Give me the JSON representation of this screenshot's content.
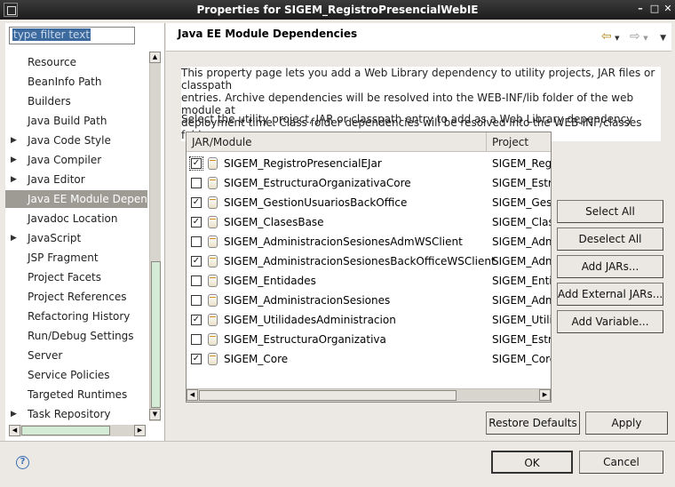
{
  "window": {
    "title": "Properties for SIGEM_RegistroPresencialWebIE",
    "minimize": "–",
    "maximize": "□",
    "close": "✕"
  },
  "filter": {
    "placeholder": "type filter text"
  },
  "tree": [
    {
      "label": "Resource",
      "expandable": false
    },
    {
      "label": "BeanInfo Path",
      "expandable": false
    },
    {
      "label": "Builders",
      "expandable": false
    },
    {
      "label": "Java Build Path",
      "expandable": false
    },
    {
      "label": "Java Code Style",
      "expandable": true
    },
    {
      "label": "Java Compiler",
      "expandable": true
    },
    {
      "label": "Java Editor",
      "expandable": true
    },
    {
      "label": "Java EE Module Depend",
      "expandable": false,
      "selected": true
    },
    {
      "label": "Javadoc Location",
      "expandable": false
    },
    {
      "label": "JavaScript",
      "expandable": true
    },
    {
      "label": "JSP Fragment",
      "expandable": false
    },
    {
      "label": "Project Facets",
      "expandable": false
    },
    {
      "label": "Project References",
      "expandable": false
    },
    {
      "label": "Refactoring History",
      "expandable": false
    },
    {
      "label": "Run/Debug Settings",
      "expandable": false
    },
    {
      "label": "Server",
      "expandable": false
    },
    {
      "label": "Service Policies",
      "expandable": false
    },
    {
      "label": "Targeted Runtimes",
      "expandable": false
    },
    {
      "label": "Task Repository",
      "expandable": true
    }
  ],
  "page": {
    "title": "Java EE Module Dependencies",
    "description_lines": [
      "This property page lets you add a Web Library dependency to utility projects, JAR files or classpath",
      "entries. Archive dependencies will be resolved into the WEB-INF/lib folder of the web module at",
      "deployment time. Class folder dependencies will be resolved into the WEB-INF/classes folder."
    ],
    "instruction": "Select the utility project, JAR or classpath entry to add as a Web Library dependency"
  },
  "table": {
    "columns": [
      "JAR/Module",
      "Project"
    ],
    "rows": [
      {
        "module": "SIGEM_RegistroPresencialEJar",
        "project": "SIGEM_Regi",
        "checked": true
      },
      {
        "module": "SIGEM_EstructuraOrganizativaCore",
        "project": "SIGEM_Estr",
        "checked": false
      },
      {
        "module": "SIGEM_GestionUsuariosBackOffice",
        "project": "SIGEM_Ges",
        "checked": true
      },
      {
        "module": "SIGEM_ClasesBase",
        "project": "SIGEM_Clas",
        "checked": true
      },
      {
        "module": "SIGEM_AdministracionSesionesAdmWSClient",
        "project": "SIGEM_Adm",
        "checked": false
      },
      {
        "module": "SIGEM_AdministracionSesionesBackOfficeWSClient",
        "project": "SIGEM_Adm",
        "checked": true
      },
      {
        "module": "SIGEM_Entidades",
        "project": "SIGEM_Entic",
        "checked": false
      },
      {
        "module": "SIGEM_AdministracionSesiones",
        "project": "SIGEM_Adm",
        "checked": false
      },
      {
        "module": "SIGEM_UtilidadesAdministracion",
        "project": "SIGEM_Utili",
        "checked": true
      },
      {
        "module": "SIGEM_EstructuraOrganizativa",
        "project": "SIGEM_Estr",
        "checked": false
      },
      {
        "module": "SIGEM_Core",
        "project": "SIGEM_Core",
        "checked": true
      }
    ]
  },
  "buttons": {
    "select_all": "Select All",
    "deselect_all": "Deselect All",
    "add_jars": "Add JARs...",
    "add_external_jars": "Add External JARs...",
    "add_variable": "Add Variable...",
    "restore_defaults": "Restore Defaults",
    "apply": "Apply",
    "ok": "OK",
    "cancel": "Cancel"
  },
  "icons": {
    "help": "?",
    "check": "✓",
    "back": "⇦",
    "forward": "⇨",
    "menu": "▼",
    "expand": "▶"
  }
}
